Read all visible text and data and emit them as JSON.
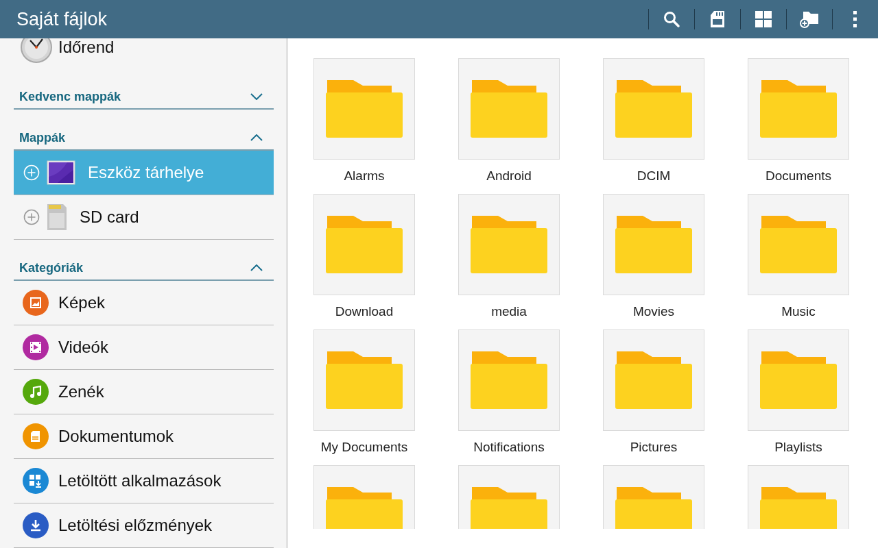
{
  "app_bar": {
    "title": "Saját fájlok",
    "actions": [
      {
        "kind": "search"
      },
      {
        "kind": "sdcard"
      },
      {
        "kind": "grid"
      },
      {
        "kind": "new_folder"
      },
      {
        "kind": "more"
      }
    ]
  },
  "sidebar": {
    "timeline": {
      "label": "Időrend"
    },
    "sections": [
      {
        "title": "Kedvenc mappák",
        "expanded": false
      },
      {
        "title": "Mappák",
        "expanded": true,
        "kind": "storage",
        "items": [
          {
            "label": "Eszköz tárhelye",
            "kind": "device",
            "selected": true
          },
          {
            "label": "SD card",
            "kind": "sdcard",
            "selected": false
          }
        ]
      },
      {
        "title": "Kategóriák",
        "expanded": true,
        "kind": "category",
        "items": [
          {
            "label": "Képek",
            "kind": "images",
            "color": "#e8661c"
          },
          {
            "label": "Videók",
            "kind": "videos",
            "color": "#b02aa0"
          },
          {
            "label": "Zenék",
            "kind": "music",
            "color": "#55a80c"
          },
          {
            "label": "Dokumentumok",
            "kind": "documents",
            "color": "#f09400"
          },
          {
            "label": "Letöltött alkalmazások",
            "kind": "apps",
            "color": "#1a88d4"
          },
          {
            "label": "Letöltési előzmények",
            "kind": "downloads",
            "color": "#2a5cc4"
          }
        ]
      }
    ]
  },
  "folders": [
    {
      "kind": "folder",
      "name": "Alarms"
    },
    {
      "kind": "folder",
      "name": "Android"
    },
    {
      "kind": "folder",
      "name": "DCIM"
    },
    {
      "kind": "folder",
      "name": "Documents"
    },
    {
      "kind": "folder",
      "name": "Download"
    },
    {
      "kind": "folder",
      "name": "media"
    },
    {
      "kind": "folder",
      "name": "Movies"
    },
    {
      "kind": "folder",
      "name": "Music"
    },
    {
      "kind": "folder",
      "name": "My Documents"
    },
    {
      "kind": "folder",
      "name": "Notifications"
    },
    {
      "kind": "folder",
      "name": "Pictures"
    },
    {
      "kind": "folder",
      "name": "Playlists"
    },
    {
      "kind": "folder"
    },
    {
      "kind": "folder"
    },
    {
      "kind": "folder"
    },
    {
      "kind": "folder"
    }
  ]
}
